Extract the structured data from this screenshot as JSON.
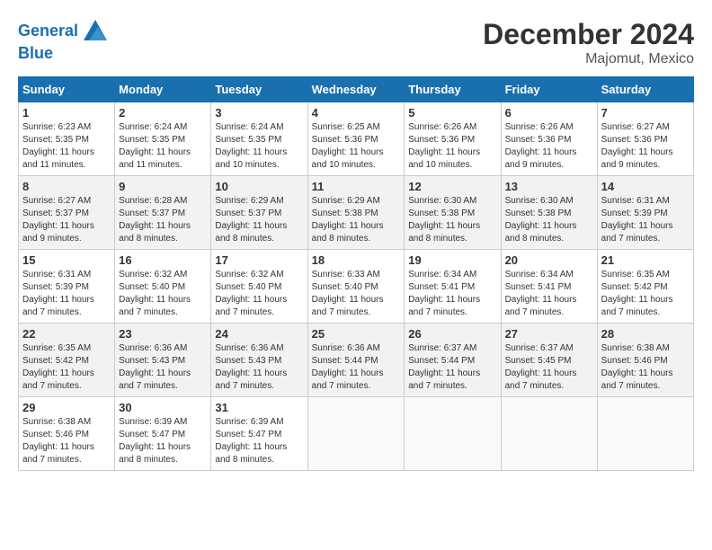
{
  "header": {
    "logo_line1": "General",
    "logo_line2": "Blue",
    "month": "December 2024",
    "location": "Majomut, Mexico"
  },
  "weekdays": [
    "Sunday",
    "Monday",
    "Tuesday",
    "Wednesday",
    "Thursday",
    "Friday",
    "Saturday"
  ],
  "weeks": [
    [
      {
        "day": "1",
        "sunrise": "6:23 AM",
        "sunset": "5:35 PM",
        "daylight": "11 hours and 11 minutes."
      },
      {
        "day": "2",
        "sunrise": "6:24 AM",
        "sunset": "5:35 PM",
        "daylight": "11 hours and 11 minutes."
      },
      {
        "day": "3",
        "sunrise": "6:24 AM",
        "sunset": "5:35 PM",
        "daylight": "11 hours and 10 minutes."
      },
      {
        "day": "4",
        "sunrise": "6:25 AM",
        "sunset": "5:36 PM",
        "daylight": "11 hours and 10 minutes."
      },
      {
        "day": "5",
        "sunrise": "6:26 AM",
        "sunset": "5:36 PM",
        "daylight": "11 hours and 10 minutes."
      },
      {
        "day": "6",
        "sunrise": "6:26 AM",
        "sunset": "5:36 PM",
        "daylight": "11 hours and 9 minutes."
      },
      {
        "day": "7",
        "sunrise": "6:27 AM",
        "sunset": "5:36 PM",
        "daylight": "11 hours and 9 minutes."
      }
    ],
    [
      {
        "day": "8",
        "sunrise": "6:27 AM",
        "sunset": "5:37 PM",
        "daylight": "11 hours and 9 minutes."
      },
      {
        "day": "9",
        "sunrise": "6:28 AM",
        "sunset": "5:37 PM",
        "daylight": "11 hours and 8 minutes."
      },
      {
        "day": "10",
        "sunrise": "6:29 AM",
        "sunset": "5:37 PM",
        "daylight": "11 hours and 8 minutes."
      },
      {
        "day": "11",
        "sunrise": "6:29 AM",
        "sunset": "5:38 PM",
        "daylight": "11 hours and 8 minutes."
      },
      {
        "day": "12",
        "sunrise": "6:30 AM",
        "sunset": "5:38 PM",
        "daylight": "11 hours and 8 minutes."
      },
      {
        "day": "13",
        "sunrise": "6:30 AM",
        "sunset": "5:38 PM",
        "daylight": "11 hours and 8 minutes."
      },
      {
        "day": "14",
        "sunrise": "6:31 AM",
        "sunset": "5:39 PM",
        "daylight": "11 hours and 7 minutes."
      }
    ],
    [
      {
        "day": "15",
        "sunrise": "6:31 AM",
        "sunset": "5:39 PM",
        "daylight": "11 hours and 7 minutes."
      },
      {
        "day": "16",
        "sunrise": "6:32 AM",
        "sunset": "5:40 PM",
        "daylight": "11 hours and 7 minutes."
      },
      {
        "day": "17",
        "sunrise": "6:32 AM",
        "sunset": "5:40 PM",
        "daylight": "11 hours and 7 minutes."
      },
      {
        "day": "18",
        "sunrise": "6:33 AM",
        "sunset": "5:40 PM",
        "daylight": "11 hours and 7 minutes."
      },
      {
        "day": "19",
        "sunrise": "6:34 AM",
        "sunset": "5:41 PM",
        "daylight": "11 hours and 7 minutes."
      },
      {
        "day": "20",
        "sunrise": "6:34 AM",
        "sunset": "5:41 PM",
        "daylight": "11 hours and 7 minutes."
      },
      {
        "day": "21",
        "sunrise": "6:35 AM",
        "sunset": "5:42 PM",
        "daylight": "11 hours and 7 minutes."
      }
    ],
    [
      {
        "day": "22",
        "sunrise": "6:35 AM",
        "sunset": "5:42 PM",
        "daylight": "11 hours and 7 minutes."
      },
      {
        "day": "23",
        "sunrise": "6:36 AM",
        "sunset": "5:43 PM",
        "daylight": "11 hours and 7 minutes."
      },
      {
        "day": "24",
        "sunrise": "6:36 AM",
        "sunset": "5:43 PM",
        "daylight": "11 hours and 7 minutes."
      },
      {
        "day": "25",
        "sunrise": "6:36 AM",
        "sunset": "5:44 PM",
        "daylight": "11 hours and 7 minutes."
      },
      {
        "day": "26",
        "sunrise": "6:37 AM",
        "sunset": "5:44 PM",
        "daylight": "11 hours and 7 minutes."
      },
      {
        "day": "27",
        "sunrise": "6:37 AM",
        "sunset": "5:45 PM",
        "daylight": "11 hours and 7 minutes."
      },
      {
        "day": "28",
        "sunrise": "6:38 AM",
        "sunset": "5:46 PM",
        "daylight": "11 hours and 7 minutes."
      }
    ],
    [
      {
        "day": "29",
        "sunrise": "6:38 AM",
        "sunset": "5:46 PM",
        "daylight": "11 hours and 7 minutes."
      },
      {
        "day": "30",
        "sunrise": "6:39 AM",
        "sunset": "5:47 PM",
        "daylight": "11 hours and 8 minutes."
      },
      {
        "day": "31",
        "sunrise": "6:39 AM",
        "sunset": "5:47 PM",
        "daylight": "11 hours and 8 minutes."
      },
      null,
      null,
      null,
      null
    ]
  ]
}
